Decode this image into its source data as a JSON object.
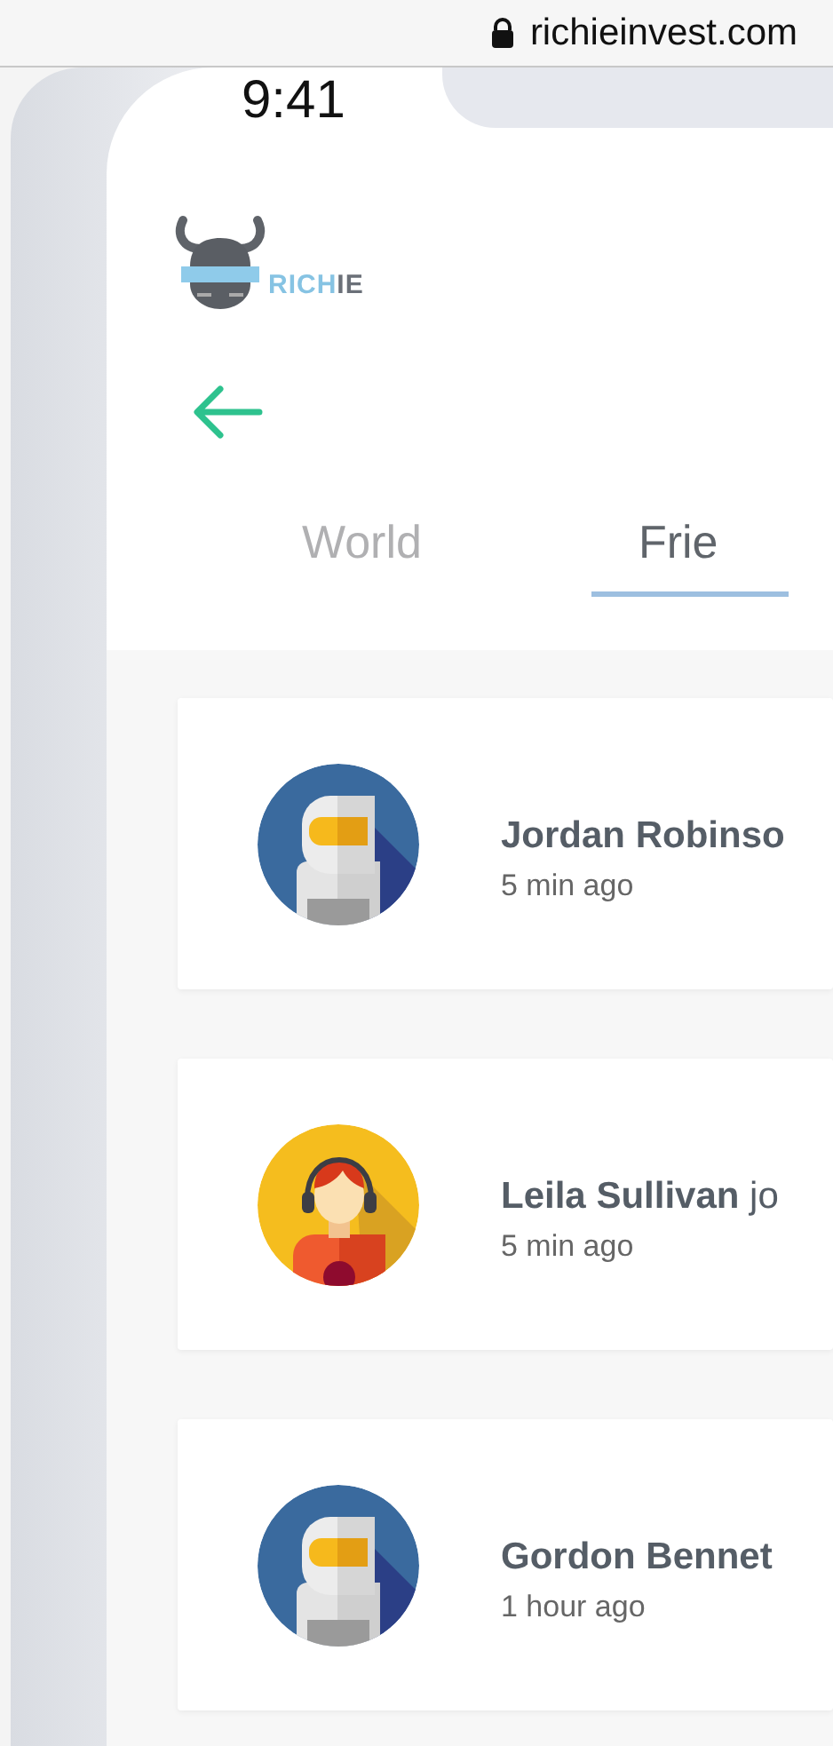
{
  "browser_bar": {
    "url": "richieinvest.com"
  },
  "status_bar": {
    "time": "9:41"
  },
  "logo": {
    "parts": [
      {
        "text": "RICH",
        "color": "#86c3e3"
      },
      {
        "text": "IE",
        "color": "#6b7078"
      }
    ]
  },
  "tabs": [
    {
      "label": "World",
      "selected": false
    },
    {
      "label": "Frie",
      "selected": true
    }
  ],
  "feed": [
    {
      "name": "Jordan Robinso",
      "time": "5 min ago",
      "kind": "astronaut"
    },
    {
      "name": "Leila Sullivan",
      "action": "jo",
      "time": "5 min ago",
      "kind": "person"
    },
    {
      "name": "Gordon Bennet",
      "time": "1 hour ago",
      "kind": "astronaut"
    }
  ]
}
